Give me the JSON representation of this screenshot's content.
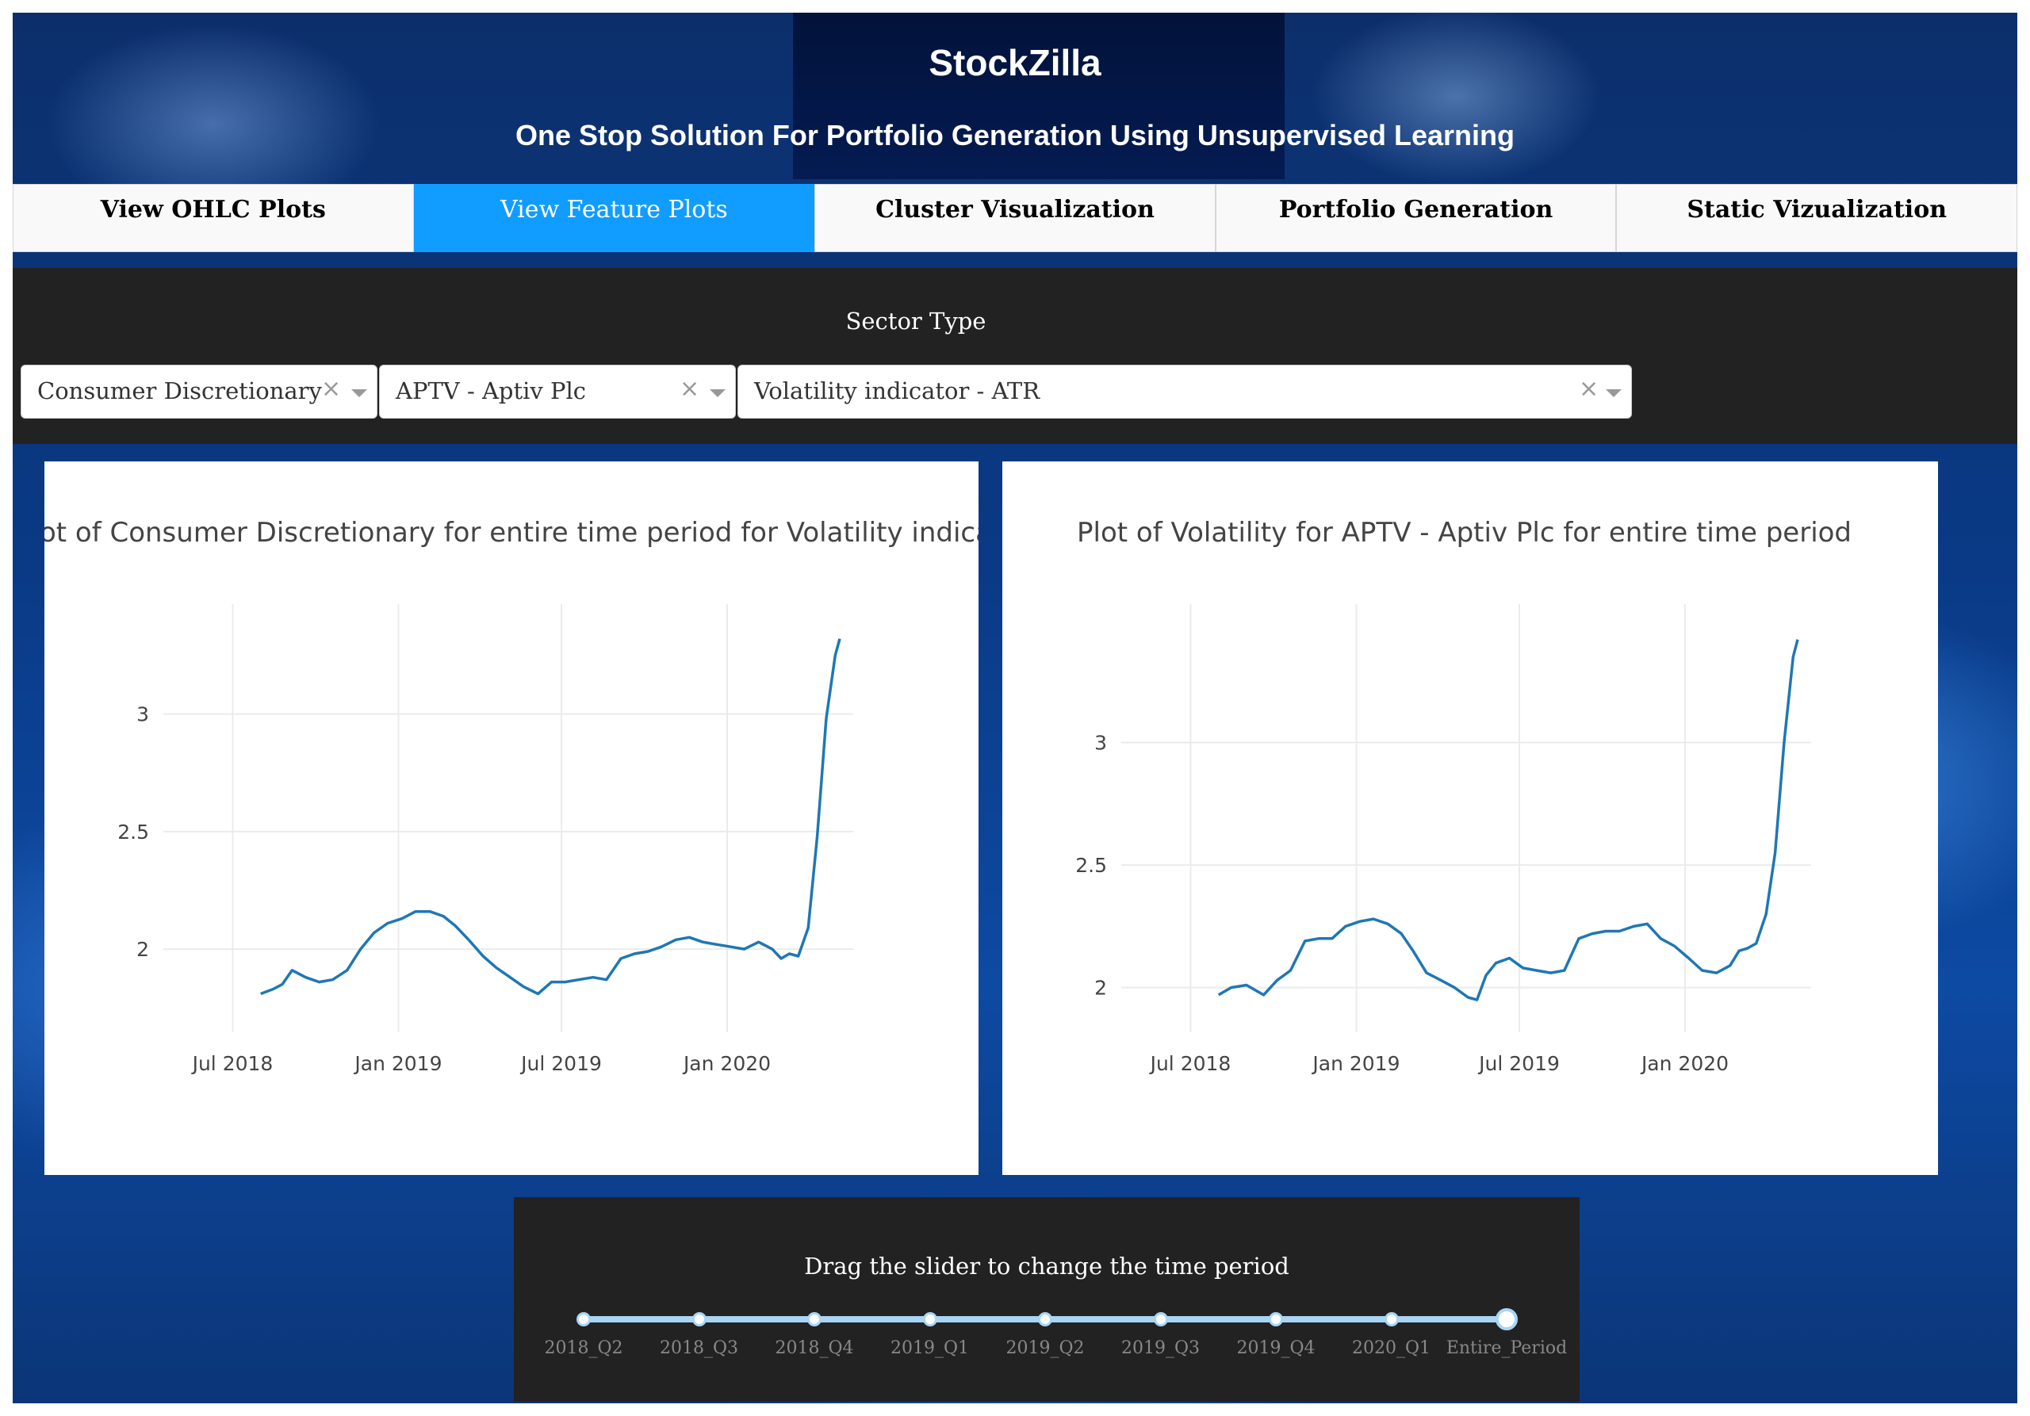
{
  "header": {
    "title": "StockZilla",
    "subtitle": "One Stop Solution For Portfolio Generation Using Unsupervised Learning"
  },
  "tabs": [
    {
      "label": "View OHLC Plots",
      "active": false
    },
    {
      "label": "View Feature Plots",
      "active": true
    },
    {
      "label": "Cluster Visualization",
      "active": false
    },
    {
      "label": "Portfolio Generation",
      "active": false
    },
    {
      "label": "Static Vizualization",
      "active": false
    }
  ],
  "controls": {
    "sector_label": "Sector Type",
    "sector_value": "Consumer Discretionary",
    "stock_value": "APTV - Aptiv Plc",
    "feature_value": "Volatility indicator - ATR",
    "clear_glyph": "×"
  },
  "slider": {
    "label": "Drag the slider to change the time period",
    "marks": [
      "2018_Q2",
      "2018_Q3",
      "2018_Q4",
      "2019_Q1",
      "2019_Q2",
      "2019_Q3",
      "2019_Q4",
      "2020_Q1",
      "Entire_Period"
    ],
    "selected": "Entire_Period",
    "accent_color": "#a9d5f5"
  },
  "colors": {
    "tab_active": "#119dff",
    "panel_dark": "#222222",
    "line": "#1f77b4"
  },
  "chart_data": [
    {
      "type": "line",
      "title": "Plot of Consumer Discretionary for entire time period for Volatility indicator - ATR",
      "x_ticks": [
        "Jul 2018",
        "Jan 2019",
        "Jul 2019",
        "Jan 2020"
      ],
      "y_ticks": [
        2,
        2.5,
        3
      ],
      "ylim": [
        1.68,
        3.4
      ],
      "xlim": [
        "2018-04-15",
        "2020-05-20"
      ],
      "series": [
        {
          "x": [
            "2018-08-01",
            "2018-08-15",
            "2018-08-25",
            "2018-09-05",
            "2018-09-20",
            "2018-10-05",
            "2018-10-20",
            "2018-11-05",
            "2018-11-20",
            "2018-12-05",
            "2018-12-20",
            "2019-01-05",
            "2019-01-20",
            "2019-02-05",
            "2019-02-20",
            "2019-03-05",
            "2019-03-20",
            "2019-04-05",
            "2019-04-20",
            "2019-05-05",
            "2019-05-20",
            "2019-06-05",
            "2019-06-20",
            "2019-07-05",
            "2019-07-20",
            "2019-08-05",
            "2019-08-20",
            "2019-09-05",
            "2019-09-20",
            "2019-10-05",
            "2019-10-20",
            "2019-11-05",
            "2019-11-20",
            "2019-12-05",
            "2019-12-20",
            "2020-01-05",
            "2020-01-20",
            "2020-02-05",
            "2020-02-20",
            "2020-03-01",
            "2020-03-10",
            "2020-03-20",
            "2020-03-31",
            "2020-04-10",
            "2020-04-20",
            "2020-04-30",
            "2020-05-05"
          ],
          "y": [
            1.81,
            1.83,
            1.85,
            1.91,
            1.88,
            1.86,
            1.87,
            1.91,
            2.0,
            2.07,
            2.11,
            2.13,
            2.16,
            2.16,
            2.14,
            2.1,
            2.04,
            1.97,
            1.92,
            1.88,
            1.84,
            1.81,
            1.86,
            1.86,
            1.87,
            1.88,
            1.87,
            1.96,
            1.98,
            1.99,
            2.01,
            2.04,
            2.05,
            2.03,
            2.02,
            2.01,
            2.0,
            2.03,
            2.0,
            1.96,
            1.98,
            1.97,
            2.09,
            2.48,
            2.98,
            3.25,
            3.32
          ]
        }
      ]
    },
    {
      "type": "line",
      "title": "Plot of Volatility for APTV - Aptiv Plc for entire time period",
      "x_ticks": [
        "Jul 2018",
        "Jan 2019",
        "Jul 2019",
        "Jan 2020"
      ],
      "y_ticks": [
        2,
        2.5,
        3
      ],
      "ylim": [
        1.85,
        3.5
      ],
      "xlim": [
        "2018-04-15",
        "2020-05-20"
      ],
      "series": [
        {
          "x": [
            "2018-08-01",
            "2018-08-15",
            "2018-09-01",
            "2018-09-20",
            "2018-10-05",
            "2018-10-20",
            "2018-11-05",
            "2018-11-20",
            "2018-12-05",
            "2018-12-20",
            "2019-01-05",
            "2019-01-20",
            "2019-02-05",
            "2019-02-20",
            "2019-03-05",
            "2019-03-20",
            "2019-04-05",
            "2019-04-20",
            "2019-05-05",
            "2019-05-15",
            "2019-05-25",
            "2019-06-05",
            "2019-06-20",
            "2019-07-05",
            "2019-07-20",
            "2019-08-05",
            "2019-08-20",
            "2019-09-05",
            "2019-09-20",
            "2019-10-05",
            "2019-10-20",
            "2019-11-05",
            "2019-11-20",
            "2019-12-05",
            "2019-12-20",
            "2020-01-05",
            "2020-01-20",
            "2020-02-05",
            "2020-02-20",
            "2020-03-01",
            "2020-03-10",
            "2020-03-20",
            "2020-03-31",
            "2020-04-10",
            "2020-04-20",
            "2020-04-30",
            "2020-05-05"
          ],
          "y": [
            1.97,
            2.0,
            2.01,
            1.97,
            2.03,
            2.07,
            2.19,
            2.2,
            2.2,
            2.25,
            2.27,
            2.28,
            2.26,
            2.22,
            2.15,
            2.06,
            2.03,
            2.0,
            1.96,
            1.95,
            2.05,
            2.1,
            2.12,
            2.08,
            2.07,
            2.06,
            2.07,
            2.2,
            2.22,
            2.23,
            2.23,
            2.25,
            2.26,
            2.2,
            2.17,
            2.12,
            2.07,
            2.06,
            2.09,
            2.15,
            2.16,
            2.18,
            2.3,
            2.55,
            3.0,
            3.35,
            3.42
          ]
        }
      ]
    }
  ]
}
